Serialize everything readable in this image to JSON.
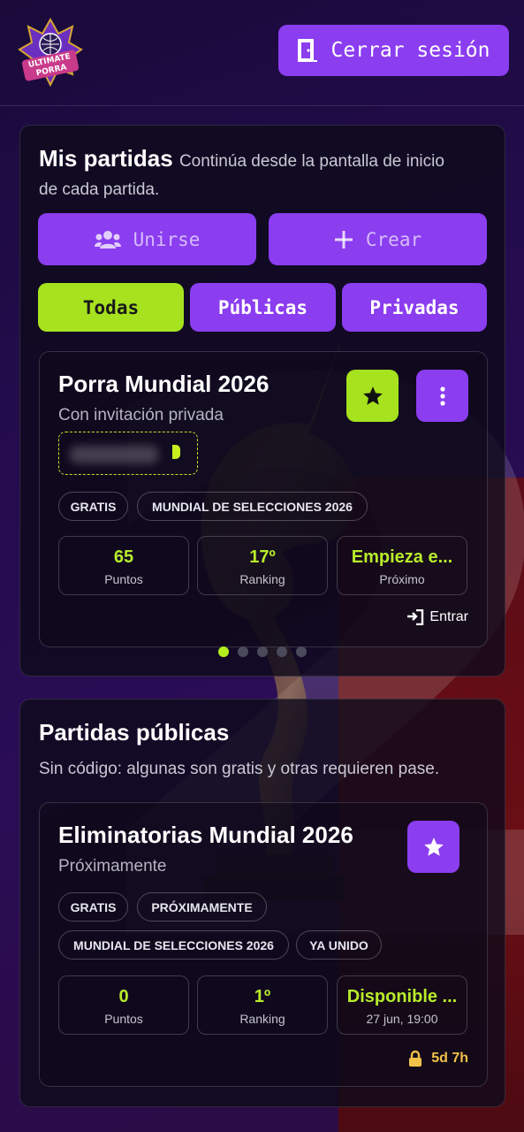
{
  "header": {
    "logo_text": [
      "ULTIMATE",
      "PORRA"
    ],
    "logout_label": "Cerrar sesión",
    "logout_icon": "door-exit-icon"
  },
  "background": {
    "number_text": "26",
    "number_color": "#ffffff",
    "accent_red": "#6a0e14"
  },
  "my_games": {
    "title": "Mis partidas",
    "subtitle_1": "Continúa desde la pantalla de inicio",
    "subtitle_2": "de cada partida.",
    "join_label": "Unirse",
    "join_icon": "users-icon",
    "create_label": "Crear",
    "create_icon": "plus-icon",
    "filters": [
      "Todas",
      "Públicas",
      "Privadas"
    ],
    "active_filter": "Todas",
    "game": {
      "title": "Porra Mundial 2026",
      "status": "Con invitación privada",
      "tags": [
        "GRATIS",
        "MUNDIAL DE SELECCIONES 2026"
      ],
      "stats": [
        {
          "value": "65",
          "label": "Puntos"
        },
        {
          "value": "17º",
          "label": "Ranking"
        },
        {
          "value": "Empieza e...",
          "label": "Próximo"
        }
      ],
      "enter_label": "Entrar"
    },
    "carousel_count": 5,
    "carousel_active": 1
  },
  "public_games": {
    "title": "Partidas públicas",
    "description": "Sin código: algunas son gratis y otras requieren pase.",
    "game": {
      "title": "Eliminatorias Mundial 2026",
      "status": "Próximamente",
      "tags": [
        "GRATIS",
        "PRÓXIMAMENTE",
        "MUNDIAL DE SELECCIONES 2026",
        "YA UNIDO"
      ],
      "stats": [
        {
          "value": "0",
          "label": "Puntos"
        },
        {
          "value": "1º",
          "label": "Ranking"
        },
        {
          "value": "Disponible ...",
          "label": "27 jun, 19:00"
        }
      ],
      "timer": "5d 7h"
    }
  },
  "colors": {
    "accent_purple": "#8b3df0",
    "accent_lime": "#a6e21e",
    "stat_value": "#b8ec2a",
    "timer": "#f2c14a"
  }
}
